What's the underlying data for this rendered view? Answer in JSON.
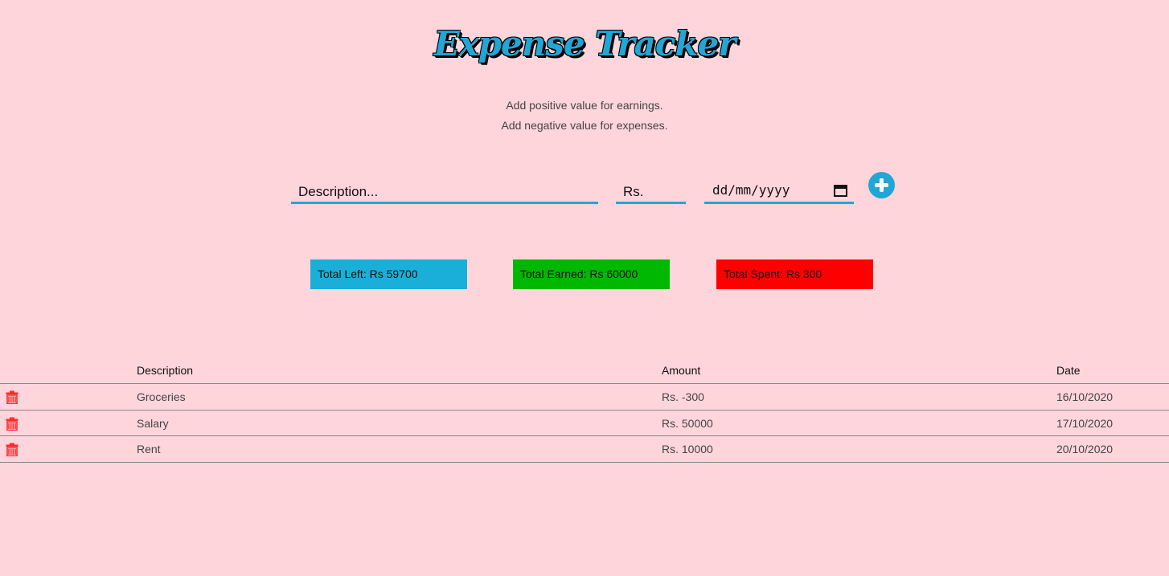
{
  "header": {
    "title": "Expense Tracker",
    "hint_line1": "Add positive value for earnings.",
    "hint_line2": "Add negative value for expenses."
  },
  "form": {
    "description_placeholder": "Description...",
    "amount_placeholder": "Rs.",
    "date_placeholder": "dd/mm/yyyy",
    "date_icon": "calendar-icon",
    "add_icon": "plus-circle-icon"
  },
  "summary": {
    "total_left": "Total Left:  Rs  59700",
    "total_earned": "Total Earned:  Rs  60000",
    "total_spent": "Total Spent:  Rs  300"
  },
  "table": {
    "headers": {
      "description": "Description",
      "amount": "Amount",
      "date": "Date"
    },
    "rows": [
      {
        "description": "Groceries",
        "amount": "Rs. -300",
        "date": "16/10/2020"
      },
      {
        "description": "Salary",
        "amount": "Rs. 50000",
        "date": "17/10/2020"
      },
      {
        "description": "Rent",
        "amount": "Rs. 10000",
        "date": "20/10/2020"
      }
    ],
    "delete_icon": "trash-icon"
  },
  "colors": {
    "background": "#ffd5dc",
    "accent": "#22a6d6",
    "total_left": "#1aafd8",
    "total_earned": "#00b800",
    "total_spent": "#ff0000",
    "delete": "#ff2a2a"
  }
}
